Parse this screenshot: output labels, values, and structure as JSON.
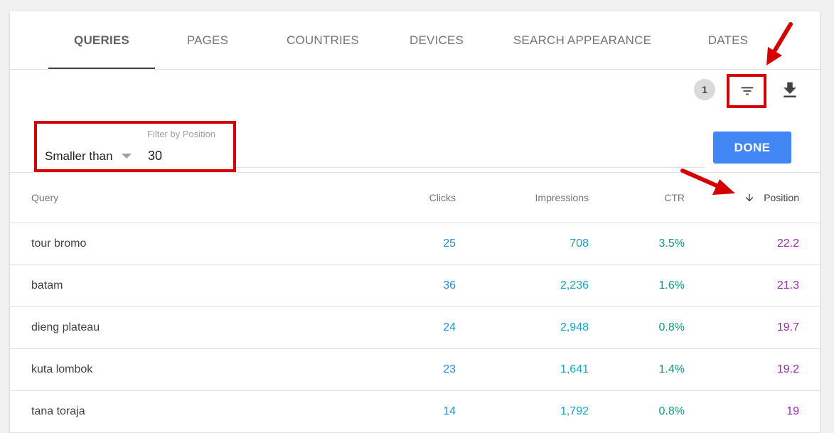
{
  "tabs": [
    {
      "label": "QUERIES",
      "active": true
    },
    {
      "label": "PAGES",
      "active": false
    },
    {
      "label": "COUNTRIES",
      "active": false
    },
    {
      "label": "DEVICES",
      "active": false
    },
    {
      "label": "SEARCH APPEARANCE",
      "active": false
    },
    {
      "label": "DATES",
      "active": false
    }
  ],
  "toolbar": {
    "filter_count": "1",
    "filter_icon": "filter-list-icon",
    "download_icon": "download-icon"
  },
  "filter": {
    "label": "Filter by Position",
    "operator": "Smaller than",
    "value": "30",
    "done_label": "DONE"
  },
  "table": {
    "columns": {
      "query": "Query",
      "clicks": "Clicks",
      "impressions": "Impressions",
      "ctr": "CTR",
      "position": "Position"
    },
    "sort": {
      "column": "position",
      "direction": "descending",
      "icon": "arrow-down-icon"
    },
    "rows": [
      {
        "query": "tour bromo",
        "clicks": "25",
        "impressions": "708",
        "ctr": "3.5%",
        "position": "22.2"
      },
      {
        "query": "batam",
        "clicks": "36",
        "impressions": "2,236",
        "ctr": "1.6%",
        "position": "21.3"
      },
      {
        "query": "dieng plateau",
        "clicks": "24",
        "impressions": "2,948",
        "ctr": "0.8%",
        "position": "19.7"
      },
      {
        "query": "kuta lombok",
        "clicks": "23",
        "impressions": "1,641",
        "ctr": "1.4%",
        "position": "19.2"
      },
      {
        "query": "tana toraja",
        "clicks": "14",
        "impressions": "1,792",
        "ctr": "0.8%",
        "position": "19"
      }
    ]
  },
  "colors": {
    "clicks": "#1a91e0",
    "impressions": "#15a4c0",
    "ctr": "#0c9a78",
    "position": "#9c27b0",
    "done_button": "#4285f4",
    "annotation": "#d40000"
  }
}
